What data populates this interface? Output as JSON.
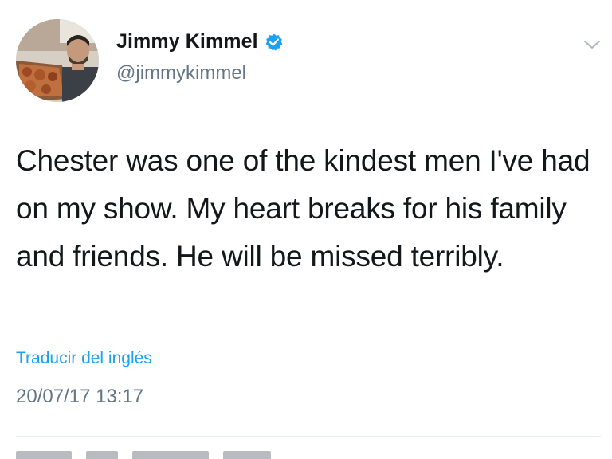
{
  "user": {
    "display_name": "Jimmy Kimmel",
    "handle": "@jimmykimmel",
    "verified": true
  },
  "tweet": {
    "text": "Chester was one of the kindest men I've had on my show. My heart breaks for his family and friends. He will be missed terribly.",
    "translate_label": "Traducir del inglés",
    "timestamp": "20/07/17 13:17"
  },
  "colors": {
    "text": "#14171a",
    "secondary": "#657786",
    "link": "#1da1f2",
    "verified_badge": "#1da1f2",
    "divider": "#e6ecf0"
  },
  "icons": {
    "verified": "verified-badge-icon",
    "menu": "chevron-down-icon"
  }
}
